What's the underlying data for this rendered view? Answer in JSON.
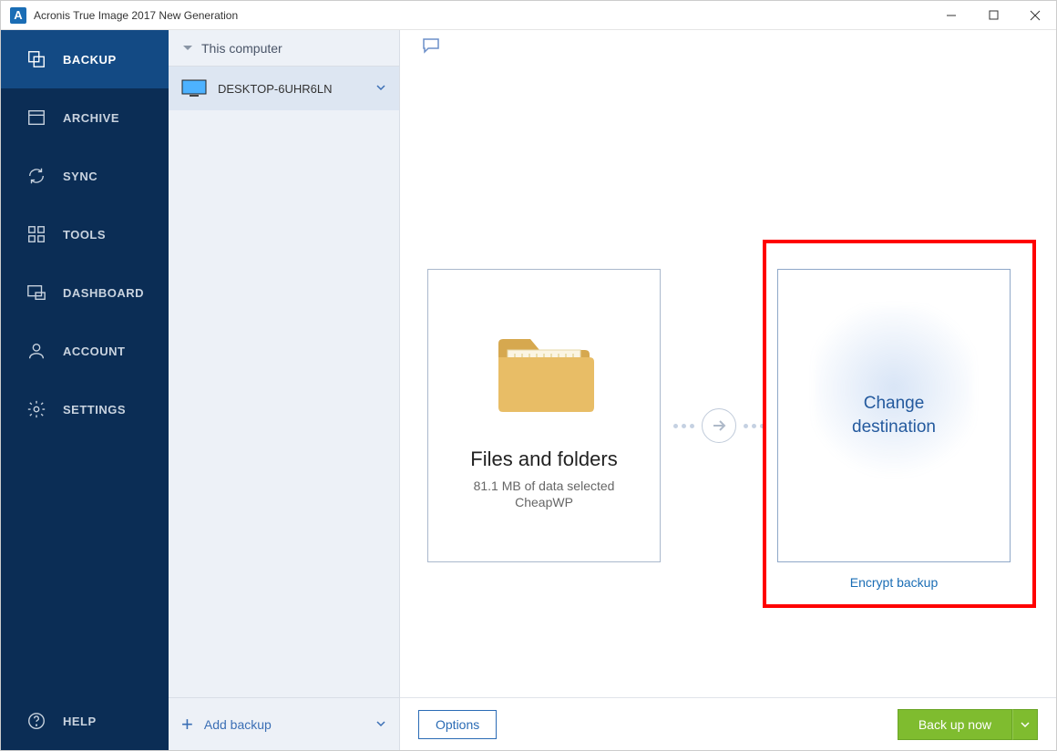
{
  "window": {
    "title": "Acronis True Image 2017 New Generation",
    "app_icon_letter": "A"
  },
  "sidebar": {
    "items": [
      {
        "label": "BACKUP"
      },
      {
        "label": "ARCHIVE"
      },
      {
        "label": "SYNC"
      },
      {
        "label": "TOOLS"
      },
      {
        "label": "DASHBOARD"
      },
      {
        "label": "ACCOUNT"
      },
      {
        "label": "SETTINGS"
      }
    ],
    "help_label": "HELP"
  },
  "listpanel": {
    "header": "This computer",
    "items": [
      {
        "label": "DESKTOP-6UHR6LN"
      }
    ],
    "add_label": "Add backup"
  },
  "main": {
    "source": {
      "title": "Files and folders",
      "subtitle1": "81.1 MB of data selected",
      "subtitle2": "CheapWP"
    },
    "destination": {
      "action_line1": "Change",
      "action_line2": "destination"
    },
    "encrypt_label": "Encrypt backup"
  },
  "footer": {
    "options_label": "Options",
    "backup_now_label": "Back up now"
  }
}
